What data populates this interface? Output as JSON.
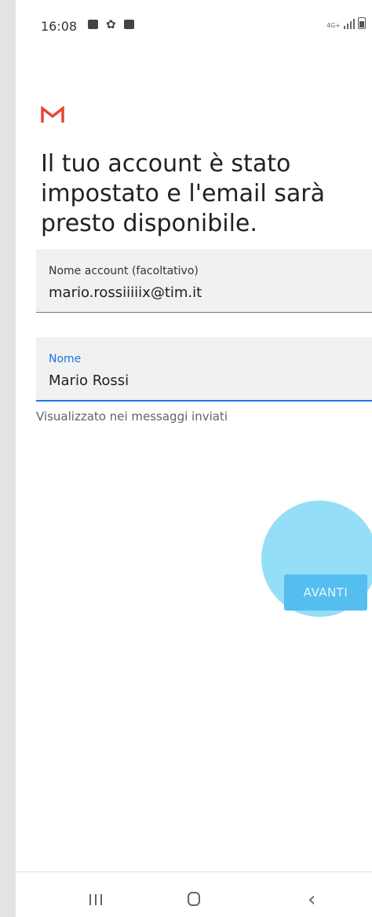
{
  "status_bar": {
    "time": "16:08",
    "network": "4G+",
    "left_icons": [
      "gallery-icon",
      "gear-icon",
      "check-square-icon"
    ]
  },
  "app": {
    "logo_icon": "gmail-icon",
    "heading": "Il tuo account è stato impostato e l'email sarà presto disponibile."
  },
  "form": {
    "account": {
      "label": "Nome account (facoltativo)",
      "value": "mario.rossiiiiix@tim.it"
    },
    "name": {
      "label": "Nome",
      "value": "Mario Rossi",
      "helper": "Visualizzato nei messaggi inviati"
    }
  },
  "actions": {
    "next_label": "AVANTI"
  },
  "navbar": {
    "icons": [
      "recents-icon",
      "home-icon",
      "back-icon"
    ]
  },
  "colors": {
    "accent": "#1a73e8",
    "button": "#55bef0",
    "gmail_red": "#ea4335"
  }
}
